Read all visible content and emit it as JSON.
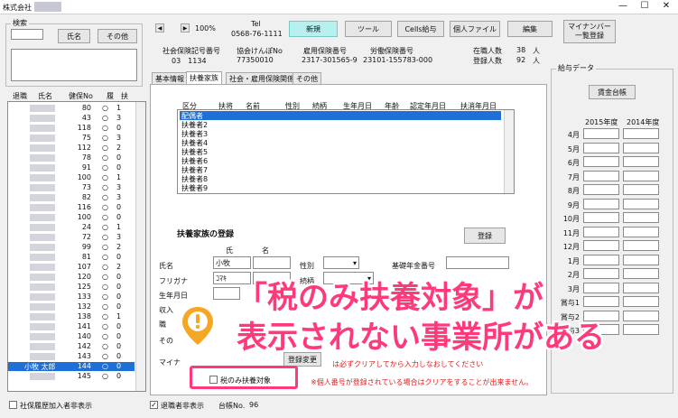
{
  "window": {
    "title": "株式会社",
    "min": "—",
    "max": "☐",
    "close": "✕"
  },
  "search": {
    "group_label": "検索",
    "name_button": "氏名",
    "other_button": "その他"
  },
  "employee_list": {
    "headers": [
      "退職",
      "氏名",
      "健保No",
      "履",
      "扶"
    ],
    "rows": [
      {
        "no": "80",
        "r": "○",
        "f": "1"
      },
      {
        "no": "43",
        "r": "○",
        "f": "3"
      },
      {
        "no": "118",
        "r": "○",
        "f": "0"
      },
      {
        "no": "75",
        "r": "○",
        "f": "3"
      },
      {
        "no": "112",
        "r": "○",
        "f": "2"
      },
      {
        "no": "78",
        "r": "○",
        "f": "0"
      },
      {
        "no": "91",
        "r": "○",
        "f": "0"
      },
      {
        "no": "100",
        "r": "○",
        "f": "1"
      },
      {
        "no": "73",
        "r": "○",
        "f": "3"
      },
      {
        "no": "82",
        "r": "○",
        "f": "3"
      },
      {
        "no": "116",
        "r": "○",
        "f": "0"
      },
      {
        "no": "100",
        "r": "○",
        "f": "0"
      },
      {
        "no": "24",
        "r": "○",
        "f": "1"
      },
      {
        "no": "72",
        "r": "○",
        "f": "3"
      },
      {
        "no": "99",
        "r": "○",
        "f": "2"
      },
      {
        "no": "81",
        "r": "○",
        "f": "0"
      },
      {
        "no": "107",
        "r": "○",
        "f": "2"
      },
      {
        "no": "120",
        "r": "○",
        "f": "0"
      },
      {
        "no": "125",
        "r": "○",
        "f": "0"
      },
      {
        "no": "133",
        "r": "○",
        "f": "0"
      },
      {
        "no": "132",
        "r": "○",
        "f": "0"
      },
      {
        "no": "138",
        "r": "○",
        "f": "1"
      },
      {
        "no": "141",
        "r": "○",
        "f": "0"
      },
      {
        "no": "140",
        "r": "○",
        "f": "0"
      },
      {
        "no": "142",
        "r": "○",
        "f": "0"
      },
      {
        "no": "143",
        "r": "○",
        "f": "0"
      },
      {
        "no": "144",
        "r": "○",
        "f": "0",
        "name": "小牧 太郎",
        "selected": true
      },
      {
        "no": "145",
        "r": "○",
        "f": "0"
      }
    ]
  },
  "toolbar": {
    "prev": "◀",
    "next": "▶",
    "zoom": "100%",
    "tel_label": "Tel",
    "tel": "0568-76-1111",
    "new_button": "新規",
    "tool_button": "ツール",
    "cells_button": "Cells給与",
    "personal_file_button": "個人ファイル",
    "edit_button": "編集",
    "mynumber_button": "マイナンバー\n一覧登録"
  },
  "company_info": {
    "shaho_label": "社会保険記号番号",
    "shaho_value": "03　1134",
    "kyokai_label": "協会けんぽNo",
    "kyokai_value": "77350010",
    "koyo_label": "雇用保険番号",
    "koyo_value": "2317-301565-9",
    "rodo_label": "労働保険番号",
    "rodo_value": "23101-155783-000",
    "zaishoku_label": "在職人数",
    "zaishoku_value": "38",
    "toroku_label": "登録人数",
    "toroku_value": "92",
    "unit": "人"
  },
  "tabs": [
    "基本情報",
    "扶養家族",
    "社会・雇用保険関係",
    "その他"
  ],
  "dependents": {
    "headers": [
      "区分",
      "扶将",
      "名前",
      "性別",
      "続柄",
      "生年月日",
      "年齢",
      "認定年月日",
      "扶消年月日"
    ],
    "rows": [
      "配偶者",
      "扶養者2",
      "扶養者3",
      "扶養者4",
      "扶養者5",
      "扶養者6",
      "扶養者7",
      "扶養者8",
      "扶養者9"
    ]
  },
  "registration": {
    "title": "扶養家族の登録",
    "register_button": "登録",
    "sei_label": "氏",
    "mei_label": "名",
    "name_label": "氏名",
    "name_value": "小牧",
    "furigana_label": "フリガナ",
    "furigana_value": "ｺﾏｷ",
    "birth_label": "生年月日",
    "income_label": "収入",
    "occupation_label": "職",
    "other_label": "その",
    "mynumber_label": "マイナ",
    "gender_label": "性別",
    "relation_label": "続柄",
    "pension_label": "基礎年金番号",
    "tax_only_checkbox": "税のみ扶養対象",
    "register_number_button": "登録変更",
    "note1": "は必ずクリアしてから入力しなおしてください",
    "note2": "※個人番号が登録されている場合はクリアをすることが出来ません。"
  },
  "salary": {
    "group_label": "給与データ",
    "wage_button": "賃金台帳",
    "year1": "2015年度",
    "year2": "2014年度",
    "months": [
      "4月",
      "5月",
      "6月",
      "7月",
      "8月",
      "9月",
      "10月",
      "11月",
      "12月",
      "1月",
      "2月",
      "3月",
      "賞与1",
      "賞与2",
      "賞与3"
    ]
  },
  "status_bar": {
    "shaho_hidden": "社保履歴加入者非表示",
    "retired_hidden": "退職者非表示",
    "register_no_label": "台帳No.",
    "register_no_value": "96"
  },
  "overlay": {
    "line1": "「税のみ扶養対象」が",
    "line2": "表示されない事業所がある",
    "accent": "#ff3a7a",
    "pin_color": "#f5a623"
  }
}
